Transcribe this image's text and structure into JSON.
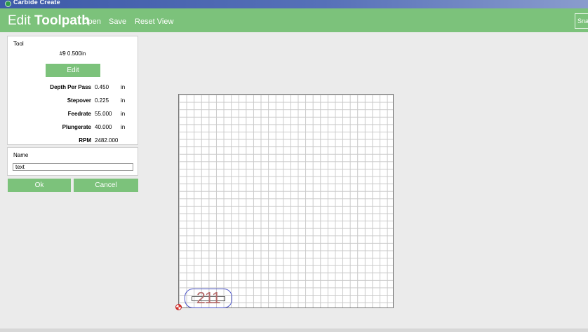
{
  "window": {
    "title": "Carbide Create"
  },
  "toolbar": {
    "title_prefix": "Edit",
    "title_main": "Toolpath",
    "open_label": "Open",
    "save_label": "Save",
    "reset_view_label": "Reset View",
    "snap_label": "Sna"
  },
  "tool_panel": {
    "heading": "Tool",
    "tool_name": "#9 0.500in",
    "edit_label": "Edit",
    "params": [
      {
        "label": "Depth Per Pass",
        "value": "0.450",
        "unit": "in"
      },
      {
        "label": "Stepover",
        "value": "0.225",
        "unit": "in"
      },
      {
        "label": "Feedrate",
        "value": "55.000",
        "unit": "in"
      },
      {
        "label": "Plungerate",
        "value": "40.000",
        "unit": "in"
      },
      {
        "label": "RPM",
        "value": "2482.000",
        "unit": ""
      }
    ]
  },
  "name_panel": {
    "heading": "Name",
    "value": "text"
  },
  "actions": {
    "ok_label": "Ok",
    "cancel_label": "Cancel"
  },
  "canvas": {
    "text_object": "211"
  },
  "colors": {
    "accent_green": "#7cc27b",
    "titlebar_blue": "#3d5aa8",
    "selection_blue": "#4d55c9",
    "origin_red": "#d8322b"
  }
}
